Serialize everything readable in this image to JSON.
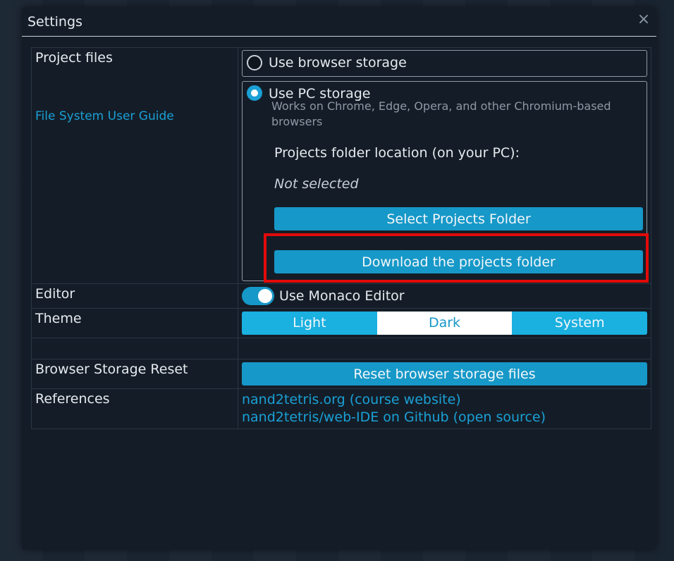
{
  "dialog": {
    "title": "Settings",
    "close_label": "×"
  },
  "project_files": {
    "label": "Project files",
    "guide_link": "File System User Guide",
    "option_browser": "Use browser storage",
    "option_pc": "Use PC storage",
    "option_pc_hint": "Works on Chrome, Edge, Opera, and other Chromium-based browsers",
    "folder_location_label": "Projects folder location (on your PC):",
    "folder_location_value": "Not selected",
    "select_folder_button": "Select Projects Folder",
    "download_folder_button": "Download the projects folder",
    "selected_option": "pc"
  },
  "editor": {
    "label": "Editor",
    "toggle_label": "Use Monaco Editor",
    "toggle_on": true
  },
  "theme": {
    "label": "Theme",
    "options": [
      "Light",
      "Dark",
      "System"
    ],
    "selected": "Dark"
  },
  "storage_reset": {
    "label": "Browser Storage Reset",
    "button": "Reset browser storage files"
  },
  "references": {
    "label": "References",
    "links": [
      "nand2tetris.org (course website)",
      "nand2tetris/web-IDE on Github (open source)"
    ]
  },
  "colors": {
    "accent": "#1698c8",
    "highlight": "#e20a0a",
    "background": "#141d27"
  }
}
